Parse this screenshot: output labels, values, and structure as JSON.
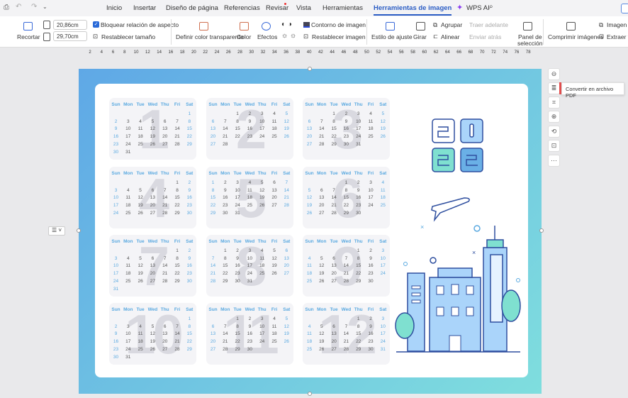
{
  "toolbar": {
    "tabs": [
      "Inicio",
      "Insertar",
      "Diseño de página",
      "Referencias",
      "Revisar",
      "Vista",
      "Herramientas",
      "Herramientas de imagen"
    ],
    "active_tab": "Herramientas de imagen",
    "wps_ai": "WPS AI"
  },
  "ribbon": {
    "crop": "Recortar",
    "width": "20,86cm",
    "height": "29,70cm",
    "lock_aspect": "Bloquear relación de aspecto",
    "lock_checked": true,
    "reset_size": "Restablecer tamaño",
    "set_transparent": "Definir color transparente",
    "color": "Color",
    "effects": "Efectos",
    "outline": "Contorno de imagen",
    "reset_image": "Restablecer imagen",
    "wrap": "Estilo de ajuste",
    "rotate": "Girar",
    "group": "Agrupar",
    "align": "Alinear",
    "bring_forward": "Traer adelante",
    "send_back": "Enviar atrás",
    "selection_pane_1": "Panel de",
    "selection_pane_2": "selección",
    "compress": "Comprimir imágenes",
    "image_to": "Imagen a",
    "extract_text": "Extraer te"
  },
  "ruler": [
    "2",
    "4",
    "6",
    "8",
    "10",
    "12",
    "14",
    "16",
    "18",
    "20",
    "22",
    "24",
    "26",
    "28",
    "30",
    "32",
    "34",
    "36",
    "38",
    "40",
    "42",
    "44",
    "46",
    "48",
    "50",
    "52",
    "54",
    "56",
    "58",
    "60",
    "62",
    "64",
    "66",
    "68",
    "70",
    "72",
    "74",
    "76",
    "78"
  ],
  "tooltip": "Convertir en archivo PDF",
  "calendar": {
    "year_art": "2022",
    "weekdays": [
      "Sun",
      "Mon",
      "Tue",
      "Wed",
      "Thu",
      "Fri",
      "Sat"
    ],
    "months": [
      {
        "n": "1",
        "start": 6,
        "days": 31
      },
      {
        "n": "2",
        "start": 2,
        "days": 28
      },
      {
        "n": "3",
        "start": 2,
        "days": 31
      },
      {
        "n": "4",
        "start": 5,
        "days": 30
      },
      {
        "n": "5",
        "start": 0,
        "days": 31
      },
      {
        "n": "6",
        "start": 3,
        "days": 30
      },
      {
        "n": "7",
        "start": 5,
        "days": 31
      },
      {
        "n": "8",
        "start": 1,
        "days": 31
      },
      {
        "n": "9",
        "start": 4,
        "days": 30
      },
      {
        "n": "10",
        "start": 6,
        "days": 31
      },
      {
        "n": "11",
        "start": 2,
        "days": 30
      },
      {
        "n": "12",
        "start": 4,
        "days": 31
      }
    ]
  },
  "colors": {
    "accent": "#2a5cc4",
    "weekend": "#5aa9e0",
    "teal": "#7fdede"
  }
}
